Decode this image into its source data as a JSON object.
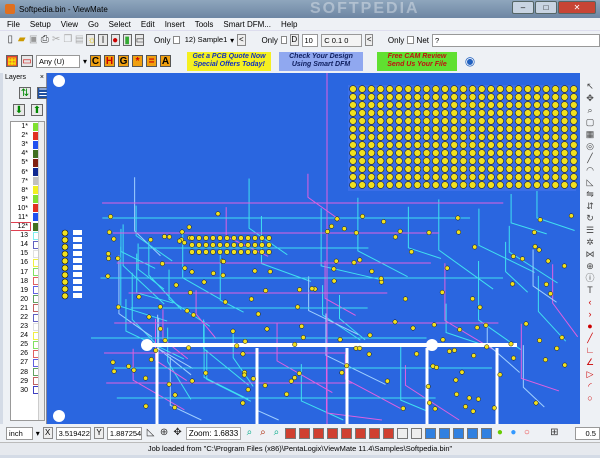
{
  "window": {
    "title": "Softpedia.bin - ViewMate",
    "watermark": "SOFTPEDIA"
  },
  "menu": [
    "File",
    "Setup",
    "View",
    "Go",
    "Select",
    "Edit",
    "Insert",
    "Tools",
    "Smart DFM...",
    "Help"
  ],
  "toolbar1": {
    "only_label_1": "Only",
    "layer_select": "12) Sample1up.cln",
    "only_label_2": "Only",
    "d_label": "D",
    "d_value": "10",
    "c_value": "C 0.1  0",
    "only_label_3": "Only",
    "net_label": "Net",
    "net_value": "?",
    "back_label": "<"
  },
  "toolbar2": {
    "filter_select": "Any    (U)",
    "letters": [
      "C",
      "H",
      "G",
      "*",
      "=",
      "A"
    ],
    "ads": [
      {
        "line1": "Get a PCB Quote Now",
        "line2": "Special Offers Today!",
        "bg": "#f5f020",
        "fg": "#1030c0"
      },
      {
        "line1": "Check Your Design",
        "line2": "Using Smart DFM",
        "bg": "#90a8f0",
        "fg": "#102060"
      },
      {
        "line1": "Free CAM Review",
        "line2": "Send Us Your File",
        "bg": "#60e030",
        "fg": "#c01010"
      }
    ]
  },
  "layers_panel": {
    "title": "Layers",
    "close": "×",
    "layers": [
      {
        "label": "1*",
        "color": "#7fe030",
        "filled": true
      },
      {
        "label": "2*",
        "color": "#e03020",
        "filled": true
      },
      {
        "label": "3*",
        "color": "#2050f0",
        "filled": true
      },
      {
        "label": "4*",
        "color": "#407020",
        "filled": true
      },
      {
        "label": "5*",
        "color": "#802010",
        "filled": true
      },
      {
        "label": "6*",
        "color": "#102890",
        "filled": true
      },
      {
        "label": "7*",
        "color": "#c0c0c0",
        "filled": true
      },
      {
        "label": "8*",
        "color": "#f0f020",
        "filled": true
      },
      {
        "label": "9*",
        "color": "#80e030",
        "filled": true
      },
      {
        "label": "10*",
        "color": "#e03020",
        "filled": true
      },
      {
        "label": "11*",
        "color": "#2050f0",
        "filled": true
      },
      {
        "label": "12*",
        "color": "#407020",
        "filled": true,
        "selected": true
      },
      {
        "label": "13",
        "color": "#80f0f0"
      },
      {
        "label": "14",
        "color": "#6060c0"
      },
      {
        "label": "15",
        "color": "#e0e0e0"
      },
      {
        "label": "16",
        "color": "#f0f040"
      },
      {
        "label": "17",
        "color": "#80e060"
      },
      {
        "label": "18",
        "color": "#e06060"
      },
      {
        "label": "19",
        "color": "#6060e0"
      },
      {
        "label": "20",
        "color": "#60a060"
      },
      {
        "label": "21",
        "color": "#c06060"
      },
      {
        "label": "22",
        "color": "#6060c0"
      },
      {
        "label": "23",
        "color": "#e0e0e0"
      },
      {
        "label": "24",
        "color": "#f0f040"
      },
      {
        "label": "25",
        "color": "#80e060"
      },
      {
        "label": "26",
        "color": "#e06060"
      },
      {
        "label": "27",
        "color": "#6060e0"
      },
      {
        "label": "28",
        "color": "#60a060"
      },
      {
        "label": "29",
        "color": "#c06060"
      },
      {
        "label": "30",
        "color": "#4040c0"
      }
    ]
  },
  "board": {
    "background": "#2a66e0",
    "pad_color": "#f0e020",
    "trace_colors": [
      "#40e0f0",
      "#e060e0",
      "#ffffff"
    ]
  },
  "statusbar": {
    "units": "inch",
    "x_label": "X",
    "x_value": "3.519422",
    "y_label": "Y",
    "y_value": "1.887254",
    "zoom_label": "Zoom: 1.6833",
    "right_value": "0.5"
  },
  "message": "Job loaded from \"C:\\Program Files (x86)\\PentaLogix\\ViewMate 11.4\\Samples\\Softpedia.bin\""
}
